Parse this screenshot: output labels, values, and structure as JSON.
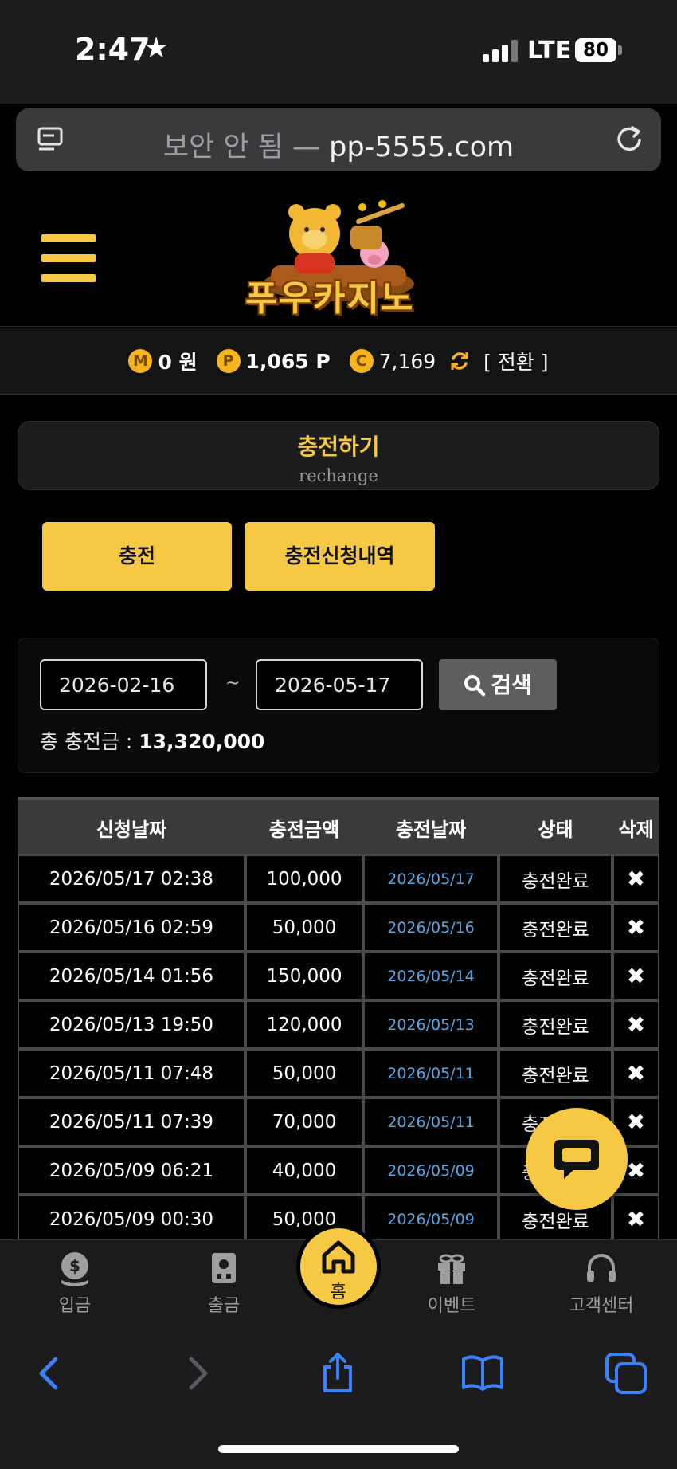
{
  "status_bar": {
    "time": "2:47",
    "network": "LTE",
    "battery": "80"
  },
  "url_bar": {
    "insecure_label": "보안 안 됨 — ",
    "domain": "pp-5555.com"
  },
  "site": {
    "logo_text": "푸우카지노"
  },
  "balance": {
    "money_icon": "M",
    "money": "0 원",
    "point_icon": "P",
    "points": "1,065 P",
    "casino_icon": "C",
    "casino": "7,169",
    "switch_label": "[ 전환 ]"
  },
  "section": {
    "title": "충전하기",
    "subtitle": "rechange"
  },
  "tabs": {
    "charge": "충전",
    "history": "충전신청내역"
  },
  "search": {
    "date_from": "2026-02-16",
    "separator": "~",
    "date_to": "2026-05-17",
    "button": "검색",
    "total_label": "총 충전금 : ",
    "total_value": "13,320,000"
  },
  "table": {
    "headers": [
      "신청날짜",
      "충전금액",
      "충전날짜",
      "상태",
      "삭제"
    ],
    "delete_symbol": "✖",
    "rows": [
      {
        "requested": "2026/05/17 02:38",
        "amount": "100,000",
        "charged": "2026/05/17",
        "status": "충전완료"
      },
      {
        "requested": "2026/05/16 02:59",
        "amount": "50,000",
        "charged": "2026/05/16",
        "status": "충전완료"
      },
      {
        "requested": "2026/05/14 01:56",
        "amount": "150,000",
        "charged": "2026/05/14",
        "status": "충전완료"
      },
      {
        "requested": "2026/05/13 19:50",
        "amount": "120,000",
        "charged": "2026/05/13",
        "status": "충전완료"
      },
      {
        "requested": "2026/05/11 07:48",
        "amount": "50,000",
        "charged": "2026/05/11",
        "status": "충전완료"
      },
      {
        "requested": "2026/05/11 07:39",
        "amount": "70,000",
        "charged": "2026/05/11",
        "status": "충전완료"
      },
      {
        "requested": "2026/05/09 06:21",
        "amount": "40,000",
        "charged": "2026/05/09",
        "status": "충전완료"
      },
      {
        "requested": "2026/05/09 00:30",
        "amount": "50,000",
        "charged": "2026/05/09",
        "status": "충전완료"
      }
    ]
  },
  "bottom_nav": {
    "deposit": "입금",
    "withdraw": "출금",
    "home": "홈",
    "event": "이벤트",
    "support": "고객센터"
  },
  "colors": {
    "accent": "#f6c844",
    "link_date": "#5aa6e6",
    "safari_blue": "#3b82f6"
  }
}
